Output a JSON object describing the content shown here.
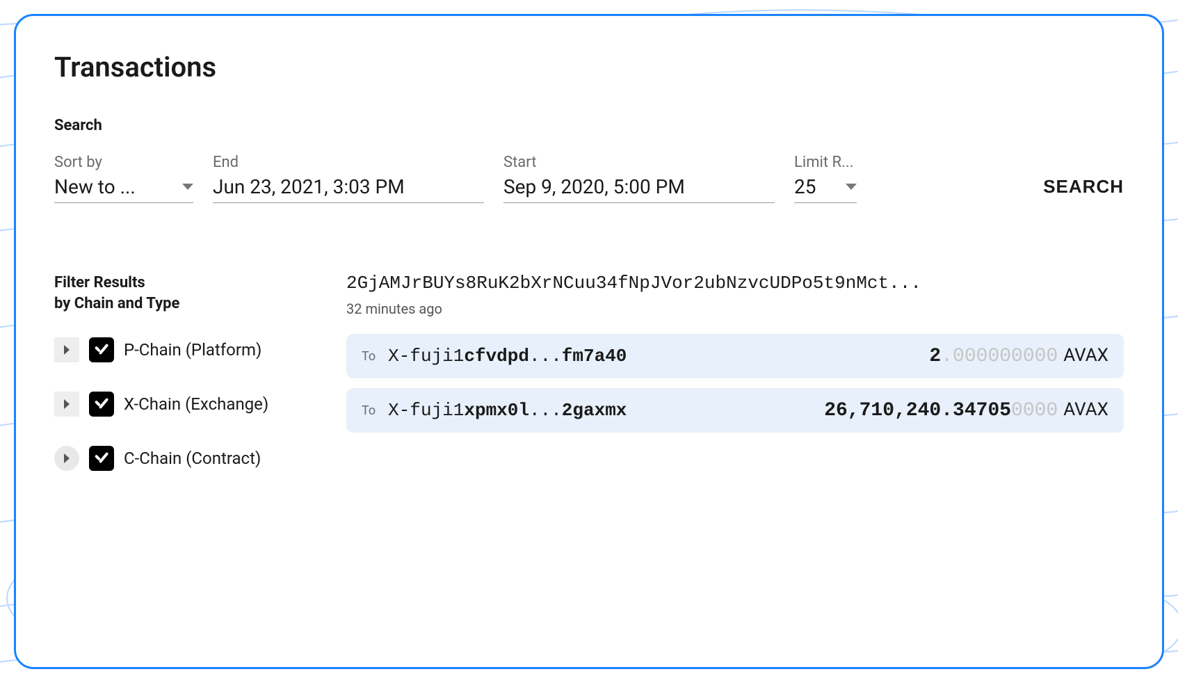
{
  "page_title": "Transactions",
  "search": {
    "heading": "Search",
    "sort": {
      "label": "Sort by",
      "value": "New to ..."
    },
    "end": {
      "label": "End",
      "value": "Jun 23, 2021, 3:03 PM"
    },
    "start": {
      "label": "Start",
      "value": "Sep 9, 2020, 5:00 PM"
    },
    "limit": {
      "label": "Limit R...",
      "value": "25"
    },
    "button_label": "SEARCH"
  },
  "filters": {
    "heading_l1": "Filter Results",
    "heading_l2": "by Chain and Type",
    "items": [
      {
        "label": "P-Chain (Platform)",
        "checked": true
      },
      {
        "label": "X-Chain (Exchange)",
        "checked": true
      },
      {
        "label": "C-Chain (Contract)",
        "checked": true
      }
    ]
  },
  "result": {
    "hash": "2GjAMJrBUYs8RuK2bXrNCuu34fNpJVor2ubNzvcUDPo5t9nMct...",
    "time_ago": "32 minutes ago",
    "rows": [
      {
        "to_label": "To",
        "addr_prefix": "X-fuji1",
        "addr_bold1": "cfvdpd",
        "addr_ellipsis": "...",
        "addr_bold2": "fm7a40",
        "amount_sig": "2",
        "amount_dim": ".000000000",
        "unit": "AVAX"
      },
      {
        "to_label": "To",
        "addr_prefix": "X-fuji1",
        "addr_bold1": "xpmx0l",
        "addr_ellipsis": "...",
        "addr_bold2": "2gaxmx",
        "amount_sig": "26,710,240.34705",
        "amount_dim": "0000",
        "unit": "AVAX"
      }
    ]
  }
}
